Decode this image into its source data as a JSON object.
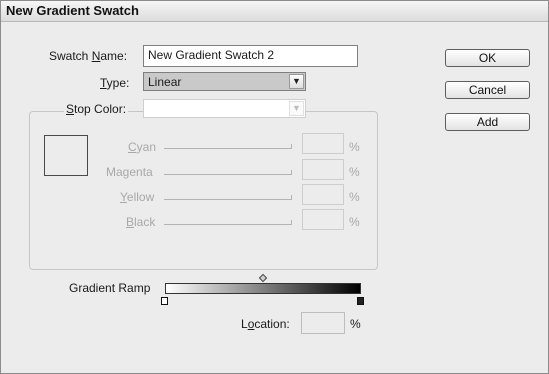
{
  "dialog": {
    "title": "New Gradient Swatch"
  },
  "fields": {
    "swatch_name": {
      "label_pre": "Swatch ",
      "label_key": "N",
      "label_post": "ame:",
      "value": "New Gradient Swatch 2"
    },
    "type": {
      "label_key": "T",
      "label_post": "ype:",
      "value": "Linear",
      "options": [
        "Linear"
      ]
    },
    "stop_color": {
      "label_key": "S",
      "label_post": "top Color:",
      "value": ""
    }
  },
  "channels": [
    {
      "name": "Cyan",
      "key": "C",
      "rest": "yan",
      "value": "",
      "unit": "%"
    },
    {
      "name": "Magenta",
      "key": "",
      "rest": "Magenta",
      "value": "",
      "unit": "%"
    },
    {
      "name": "Yellow",
      "key": "Y",
      "rest": "ellow",
      "value": "",
      "unit": "%"
    },
    {
      "name": "Black",
      "key": "B",
      "rest": "lack",
      "value": "",
      "unit": "%"
    }
  ],
  "gradient": {
    "ramp_label": "Gradient Ramp",
    "location_pre": "L",
    "location_key": "o",
    "location_post": "cation:",
    "location_value": "",
    "location_unit": "%"
  },
  "buttons": {
    "ok": "OK",
    "cancel": "Cancel",
    "add": "Add"
  },
  "icons": {
    "dropdown": "chevron-down-icon"
  }
}
